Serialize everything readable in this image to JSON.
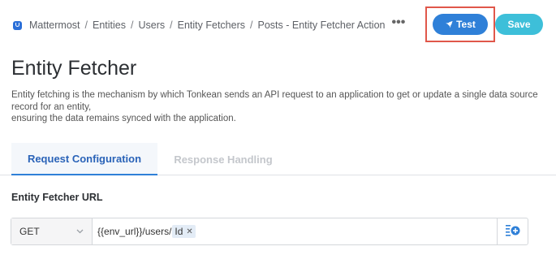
{
  "breadcrumb": {
    "items": [
      "Mattermost",
      "Entities",
      "Users",
      "Entity Fetchers",
      "Posts - Entity Fetcher Action"
    ],
    "separator": "/",
    "more": "•••"
  },
  "header": {
    "test_label": "Test",
    "save_label": "Save"
  },
  "page": {
    "title": "Entity Fetcher",
    "description_line1": "Entity fetching is the mechanism by which Tonkean sends an API request to an application to get or update a single data source record for an entity,",
    "description_line2": "ensuring the data remains synced with the application."
  },
  "tabs": [
    {
      "label": "Request Configuration"
    },
    {
      "label": "Response Handling"
    }
  ],
  "url_field": {
    "label": "Entity Fetcher URL",
    "method": "GET",
    "url_prefix": "{{env_url}}/users/",
    "variable": "Id",
    "variable_remove": "✕"
  },
  "colors": {
    "primary": "#2f80d8",
    "save": "#3dbfd9",
    "highlight": "#e0574a"
  },
  "icons": {
    "test": "rocket-icon",
    "add_variable": "add-variable-icon",
    "dropdown": "chevron-down-icon"
  }
}
